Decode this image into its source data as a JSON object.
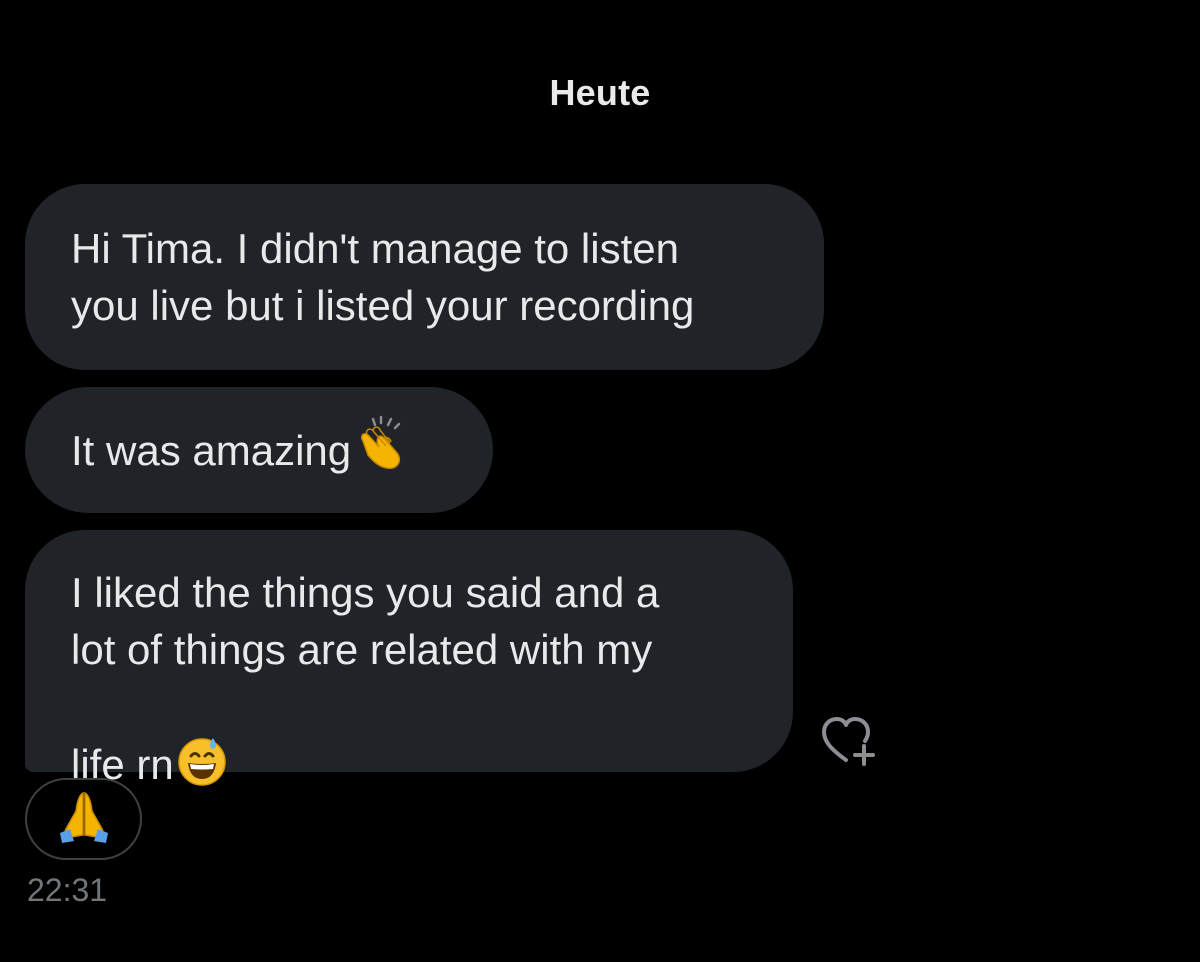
{
  "conversation": {
    "date_divider": "Heute",
    "messages": [
      {
        "text": "Hi Tima. I didn't manage to listen\nyou live but i listed your recording",
        "emoji": ""
      },
      {
        "text": "It was amazing",
        "emoji": "clapping-hands"
      },
      {
        "text": "I liked the things you said and a\nlot of things are related with my\nlife rn",
        "emoji": "grinning-face-with-sweat"
      }
    ],
    "reaction": {
      "emoji": "folded-hands"
    },
    "timestamp": "22:31",
    "add_reaction_icon": "heart-plus-icon"
  },
  "colors": {
    "background": "#000000",
    "bubble": "#202327",
    "text": "#e7e9ea",
    "muted": "#71767b"
  }
}
